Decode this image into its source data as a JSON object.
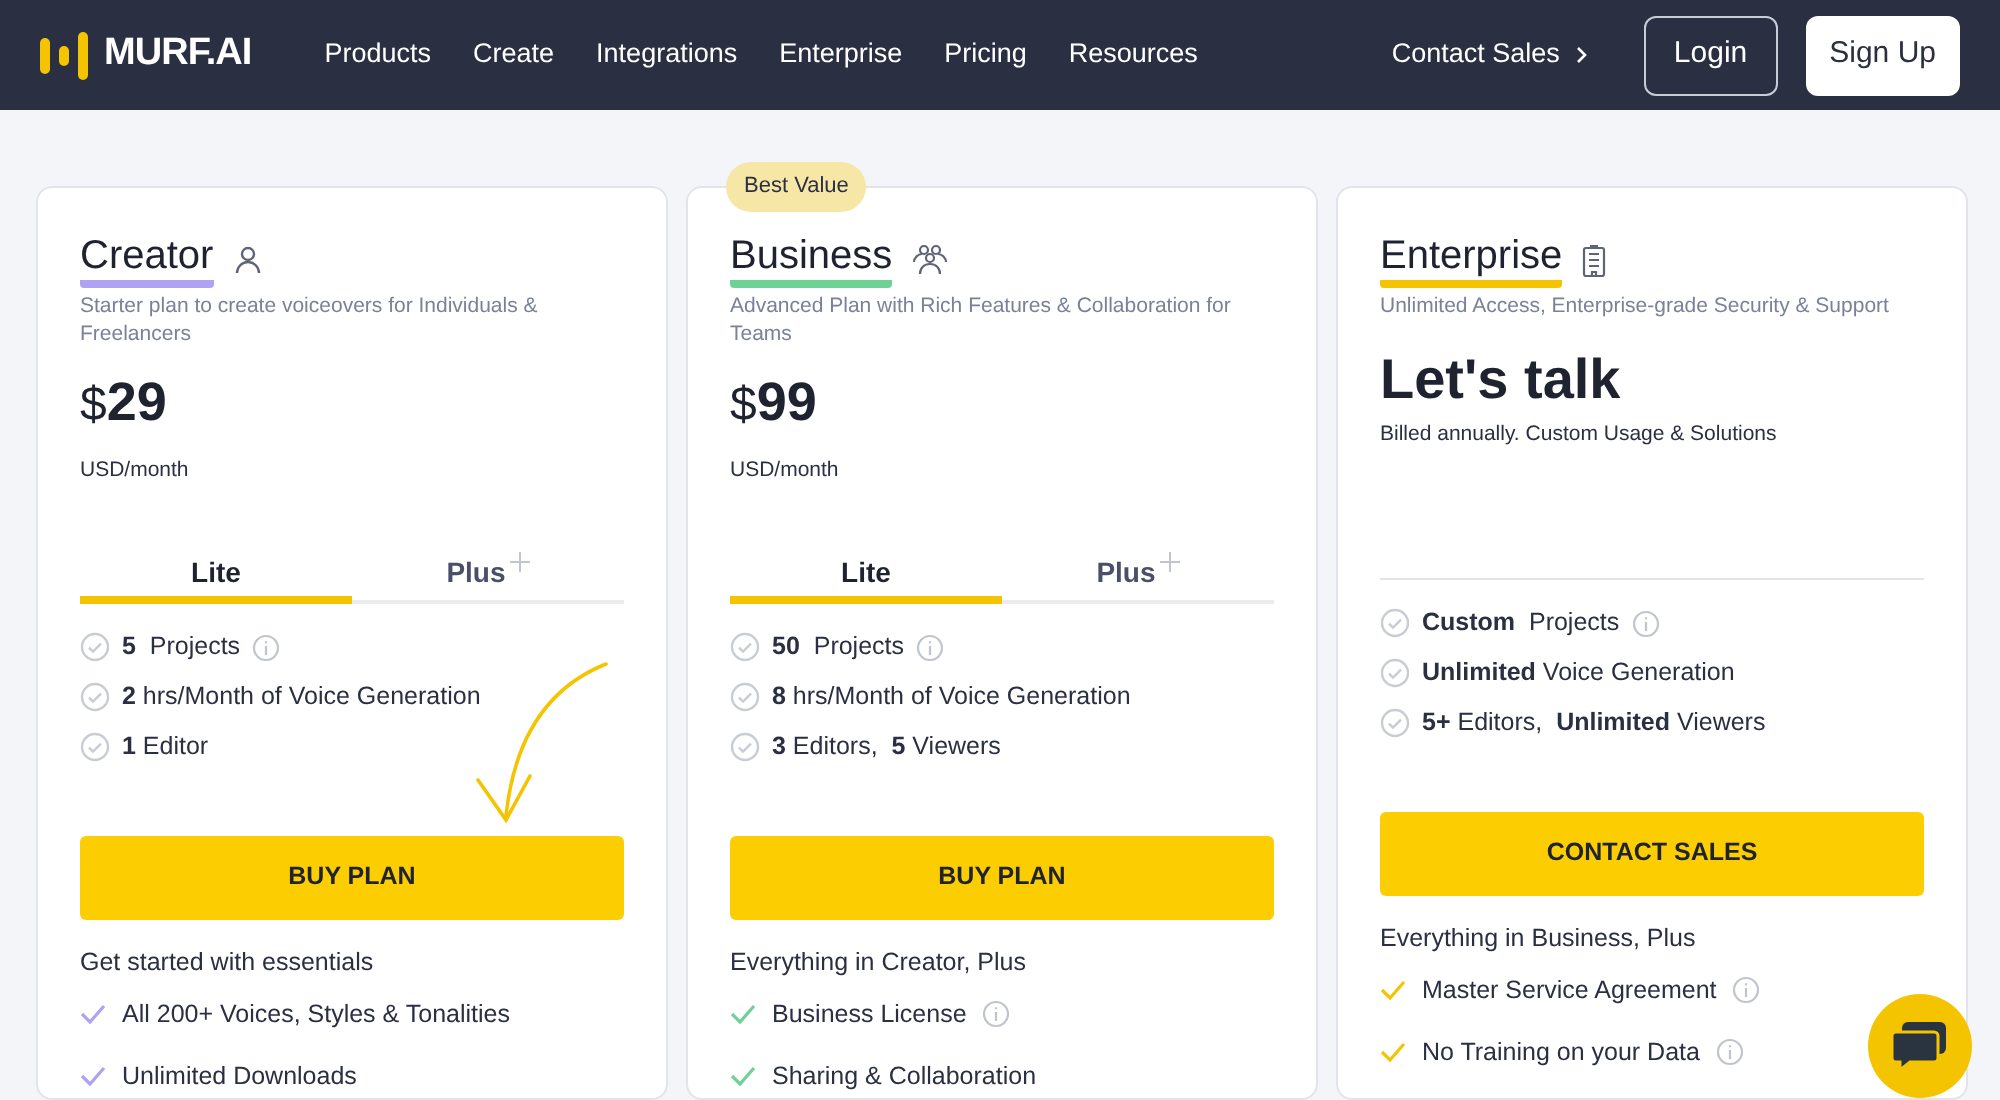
{
  "nav": {
    "logo_text": "MURF.AI",
    "links": [
      "Products",
      "Create",
      "Integrations",
      "Enterprise",
      "Pricing",
      "Resources"
    ],
    "contact": "Contact Sales",
    "login": "Login",
    "signup": "Sign Up"
  },
  "plans": [
    {
      "name": "Creator",
      "color": "#b0a2f3",
      "description": "Starter plan to create voiceovers for Individuals & Freelancers",
      "currency": "$",
      "price": "29",
      "period": "USD/month",
      "tabs": [
        {
          "label": "Lite",
          "selected": true,
          "plus": false
        },
        {
          "label": "Plus",
          "selected": false,
          "plus": true
        }
      ],
      "quotas": [
        {
          "text": "**5**  Projects",
          "info": true
        },
        {
          "text": "**2** hrs/Month of Voice Generation",
          "info": false
        },
        {
          "text": "**1** Editor",
          "info": false
        }
      ],
      "button": "BUY PLAN",
      "extras_heading": "Get started with essentials",
      "extras": [
        {
          "text": "All 200+ Voices, Styles & Tonalities",
          "info": false
        },
        {
          "text": "Unlimited Downloads",
          "info": false
        }
      ]
    },
    {
      "name": "Business",
      "color": "#6fd196",
      "badge": "Best Value",
      "description": "Advanced Plan with Rich Features & Collaboration for Teams",
      "currency": "$",
      "price": "99",
      "period": "USD/month",
      "tabs": [
        {
          "label": "Lite",
          "selected": true,
          "plus": false
        },
        {
          "label": "Plus",
          "selected": false,
          "plus": true
        }
      ],
      "quotas": [
        {
          "text": "**50**  Projects",
          "info": true
        },
        {
          "text": "**8** hrs/Month of Voice Generation",
          "info": false
        },
        {
          "text": "**3** Editors,  **5** Viewers",
          "info": false
        }
      ],
      "button": "BUY PLAN",
      "extras_heading": "Everything in Creator, Plus",
      "extras": [
        {
          "text": "Business License",
          "info": true
        },
        {
          "text": "Sharing & Collaboration",
          "info": false
        }
      ]
    },
    {
      "name": "Enterprise",
      "color": "#f5c400",
      "description": "Unlimited Access, Enterprise-grade Security & Support",
      "price": "Let's talk",
      "period": "Billed annually. Custom Usage & Solutions",
      "quotas": [
        {
          "text": "**Custom**  Projects",
          "info": true
        },
        {
          "text": "**Unlimited** Voice Generation",
          "info": false
        },
        {
          "text": "**5+** Editors,  **Unlimited** Viewers",
          "info": false
        }
      ],
      "button": "CONTACT SALES",
      "extras_heading": "Everything in Business, Plus",
      "extras": [
        {
          "text": "Master Service Agreement",
          "info": true
        },
        {
          "text": "No Training on your Data",
          "info": true
        }
      ]
    }
  ]
}
